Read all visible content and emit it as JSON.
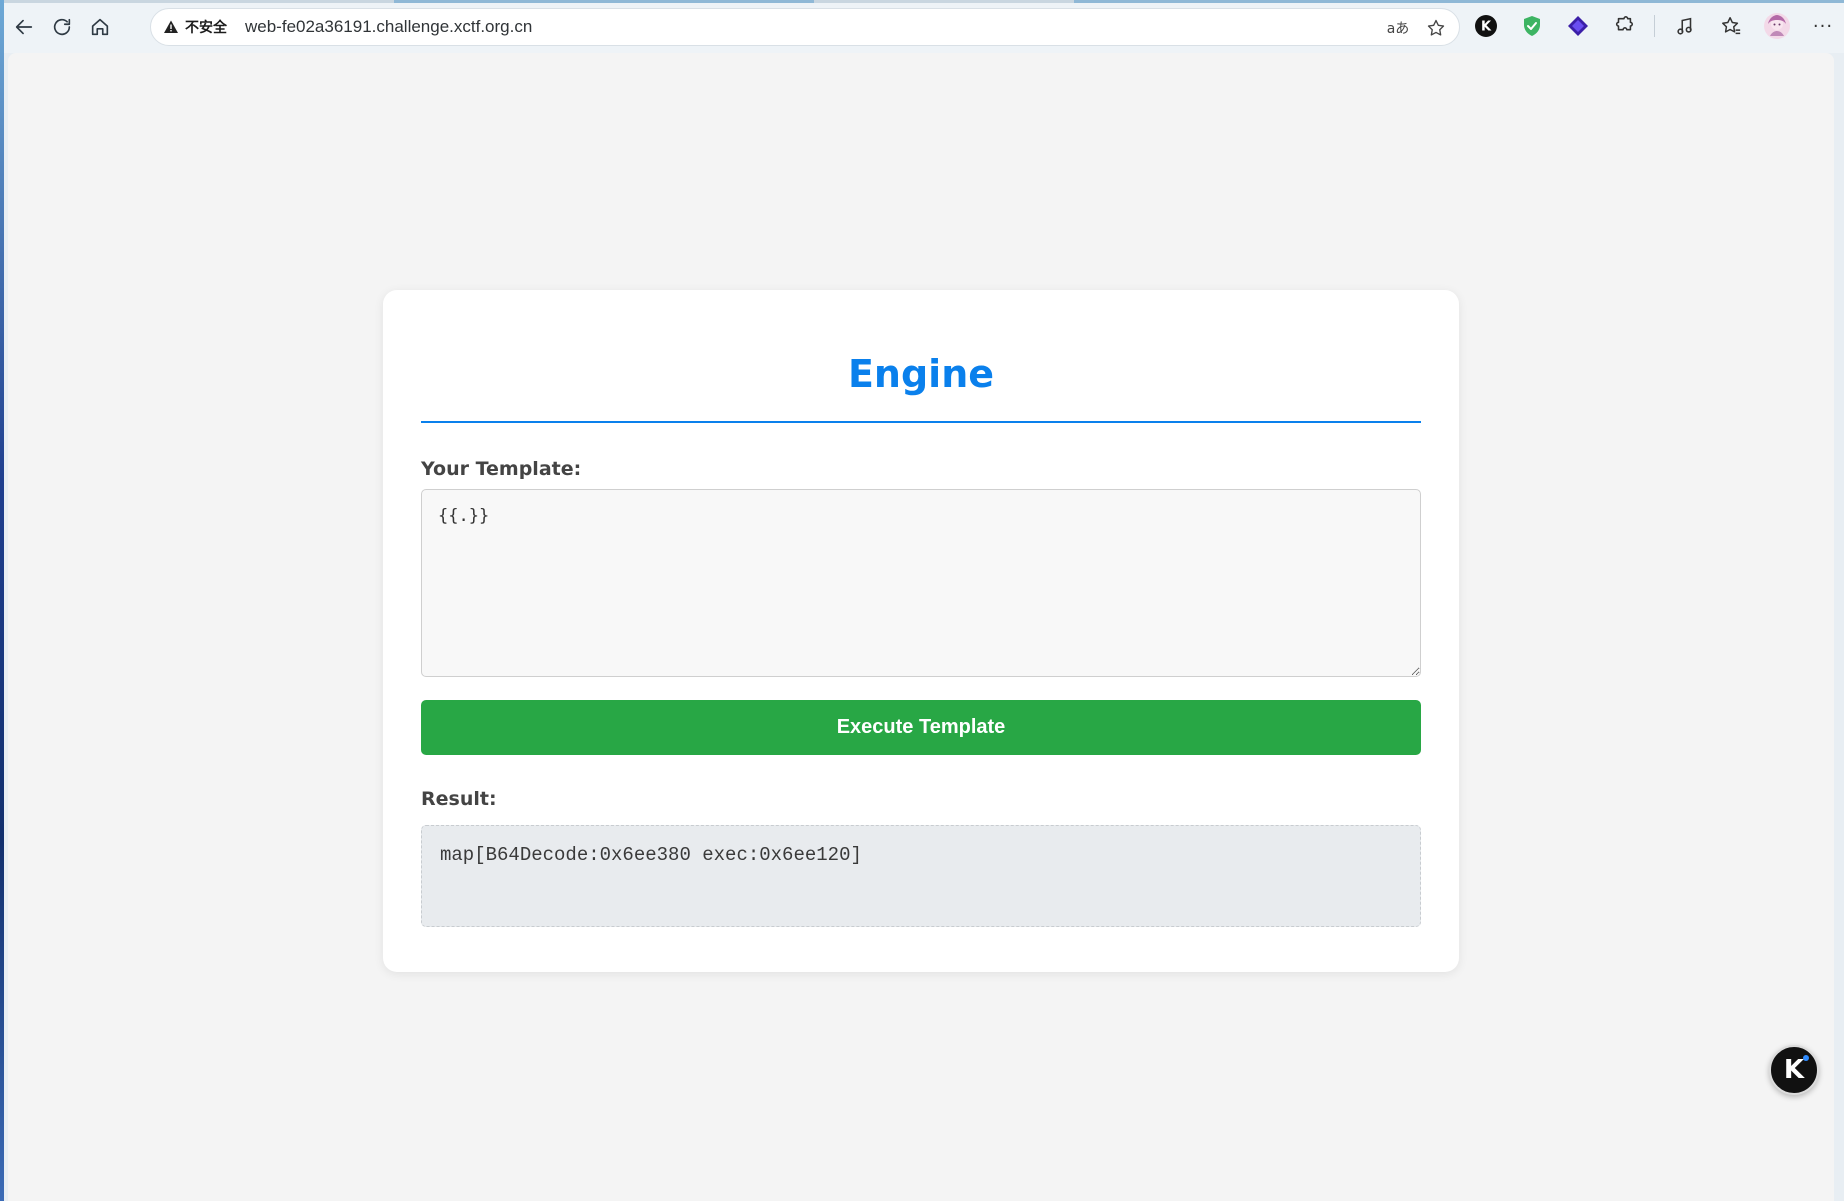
{
  "browser": {
    "security_label": "不安全",
    "url": "web-fe02a36191.challenge.xctf.org.cn",
    "translate_glyph": "aあ",
    "more_glyph": "···"
  },
  "page": {
    "title": "Engine",
    "template_label": "Your Template:",
    "template_value": "{{.}}",
    "execute_button": "Execute Template",
    "result_label": "Result:",
    "result_value": "map[B64Decode:0x6ee380 exec:0x6ee120]"
  },
  "floating_widget": {
    "letter": "K"
  },
  "colors": {
    "title_accent": "#0a80ec",
    "button_green": "#28a745",
    "page_background": "#f4f4f4",
    "result_background": "#e8ebee"
  },
  "icons": {
    "back": "back-arrow-icon",
    "refresh": "refresh-icon",
    "home": "home-icon",
    "warning": "warning-triangle-icon",
    "translate": "translate-icon",
    "favorite": "star-icon",
    "ext_k": "k-extension-icon",
    "ext_shield": "shield-extension-icon",
    "ext_diamond": "diamond-extension-icon",
    "extensions": "puzzle-icon",
    "media": "media-icon",
    "favorites": "favorites-icon",
    "profile": "profile-avatar-icon",
    "menu": "more-menu-icon"
  }
}
